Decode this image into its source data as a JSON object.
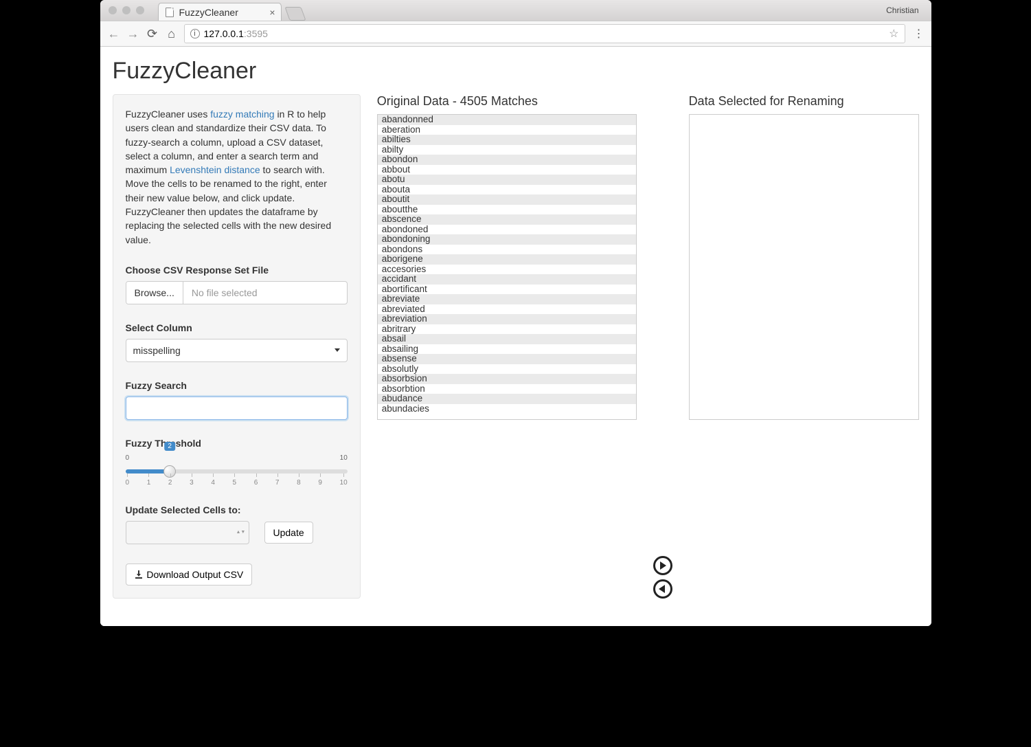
{
  "browser": {
    "tab_title": "FuzzyCleaner",
    "profile_name": "Christian",
    "url_host": "127.0.0.1",
    "url_port": ":3595"
  },
  "app_title": "FuzzyCleaner",
  "intro": {
    "text1": "FuzzyCleaner uses ",
    "link1": "fuzzy matching",
    "text2": " in R to help users clean and standardize their CSV data. To fuzzy-search a column, upload a CSV dataset, select a column, and enter a search term and maximum ",
    "link2": "Levenshtein distance",
    "text3": " to search with. Move the cells to be renamed to the right, enter their new value below, and click update. FuzzyCleaner then updates the dataframe by replacing the selected cells with the new desired value."
  },
  "labels": {
    "choose_file": "Choose CSV Response Set File",
    "browse": "Browse...",
    "no_file": "No file selected",
    "select_column": "Select Column",
    "column_value": "misspelling",
    "fuzzy_search": "Fuzzy Search",
    "fuzzy_threshold": "Fuzzy Threshold",
    "update_cells": "Update Selected Cells to:",
    "update_btn": "Update",
    "download_btn": " Download Output CSV"
  },
  "slider": {
    "min": "0",
    "max": "10",
    "value": "2",
    "ticks": [
      "0",
      "1",
      "2",
      "3",
      "4",
      "5",
      "6",
      "7",
      "8",
      "9",
      "10"
    ]
  },
  "original": {
    "title": "Original Data - 4505 Matches",
    "items": [
      "abandonned",
      "aberation",
      "abilties",
      "abilty",
      "abondon",
      "abbout",
      "abotu",
      "abouta",
      "aboutit",
      "aboutthe",
      "abscence",
      "abondoned",
      "abondoning",
      "abondons",
      "aborigene",
      "accesories",
      "accidant",
      "abortificant",
      "abreviate",
      "abreviated",
      "abreviation",
      "abritrary",
      "absail",
      "absailing",
      "absense",
      "absolutly",
      "absorbsion",
      "absorbtion",
      "abudance",
      "abundacies"
    ]
  },
  "selected": {
    "title": "Data Selected for Renaming",
    "items": []
  }
}
